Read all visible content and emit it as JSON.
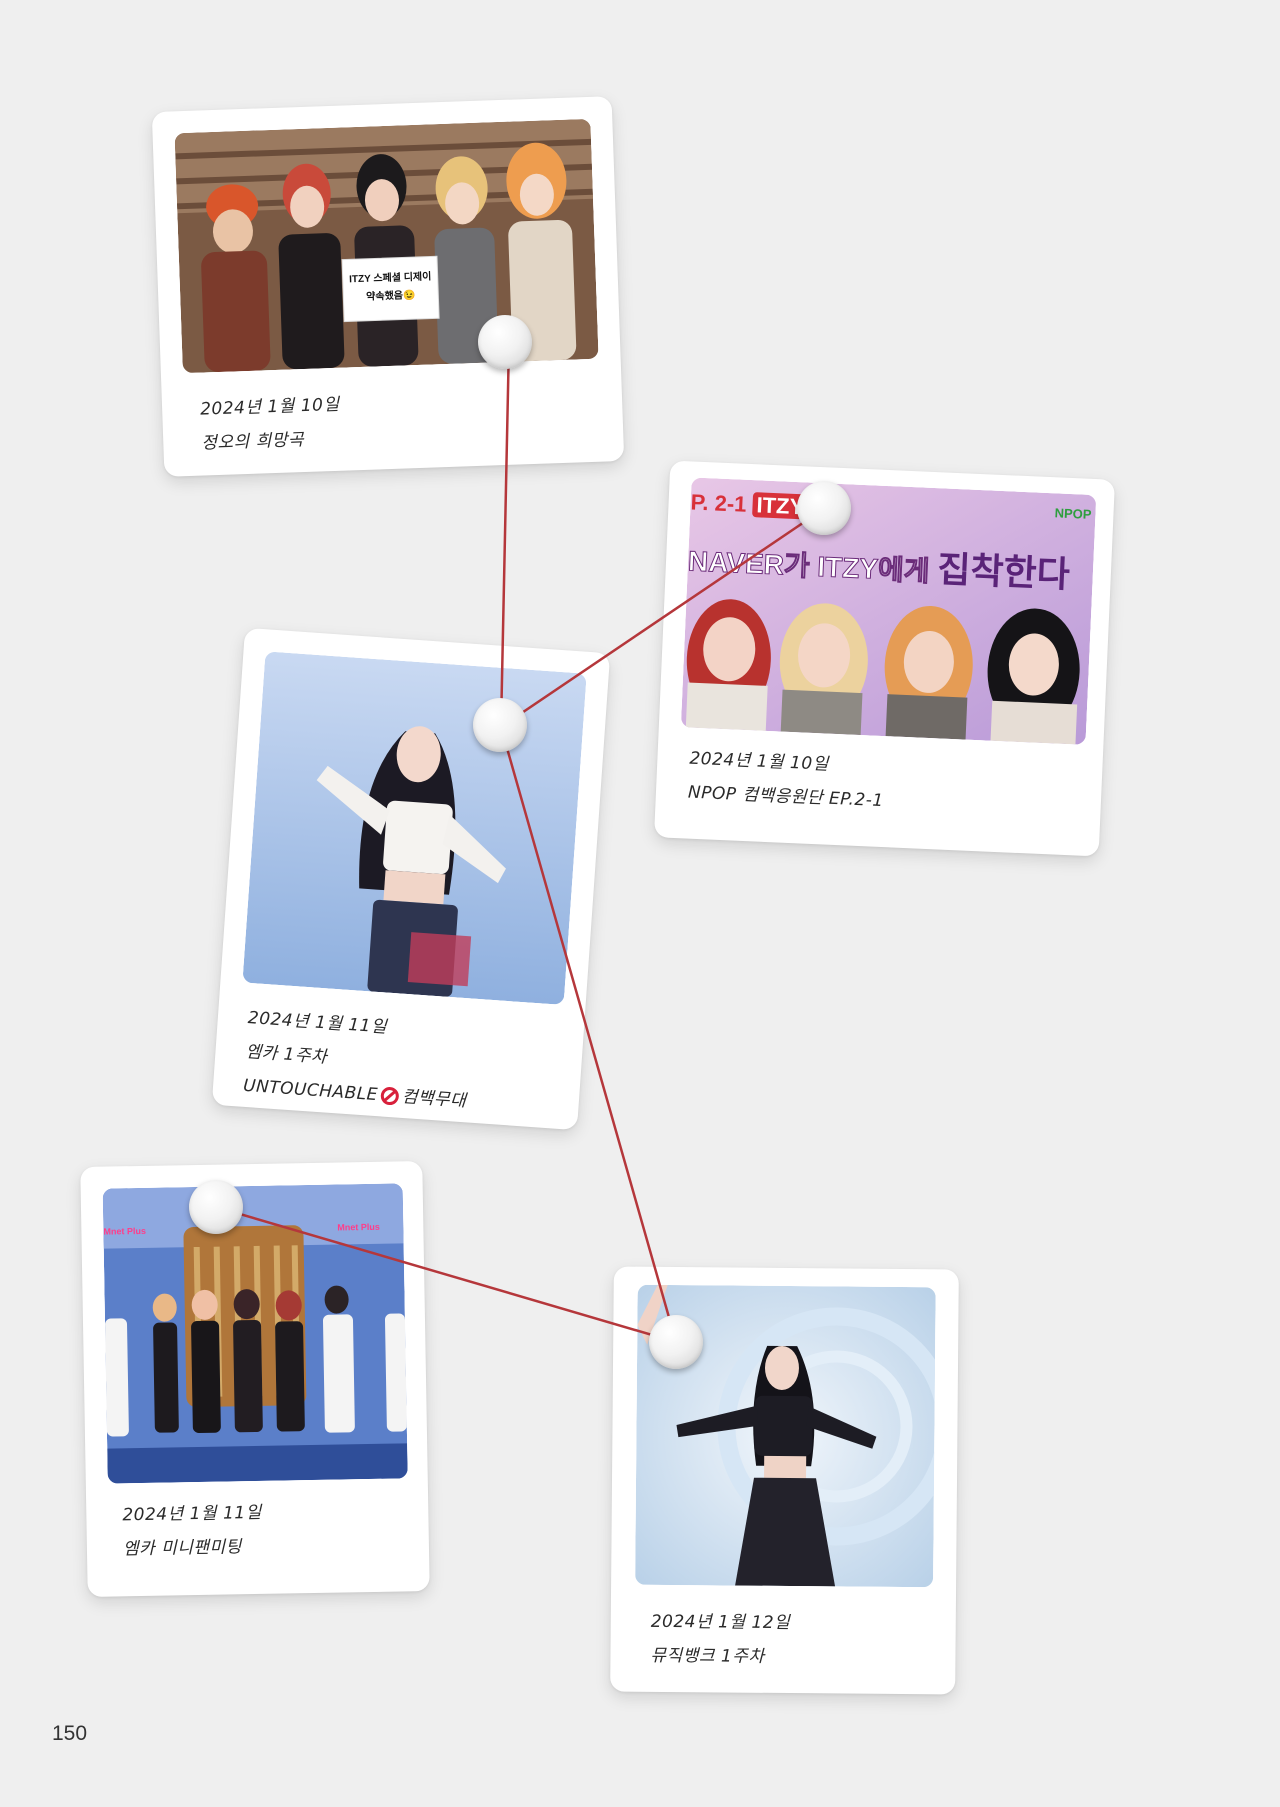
{
  "page_number": "150",
  "cards": [
    {
      "id": "card-1",
      "lines": [
        "2024년 1월 10일",
        "정오의 희망곡"
      ],
      "photo_sign_lines": [
        "ITZY 스페셜 디제이",
        "약속했음😉"
      ]
    },
    {
      "id": "card-2",
      "lines": [
        "2024년 1월 10일",
        "NPOP 컴백응원단 EP.2-1"
      ],
      "photo_overlay": {
        "episode": "P. 2-1",
        "group": "ITZY",
        "headline_part1": "NAVER가 ITZY에게",
        "headline_part2": "집착한다",
        "badge": "NPOP"
      }
    },
    {
      "id": "card-3",
      "lines": [
        "2024년 1월 11일",
        "엠카 1주차"
      ],
      "line3_prefix": "UNTOUCHABLE",
      "line3_suffix": "컴백무대"
    },
    {
      "id": "card-4",
      "lines": [
        "2024년 1월 11일",
        "엠카 미니팬미팅"
      ],
      "photo_logo": "Mnet Plus"
    },
    {
      "id": "card-5",
      "lines": [
        "2024년 1월 12일",
        "뮤직뱅크 1주차"
      ]
    }
  ],
  "colors": {
    "background": "#efefef",
    "string": "#b5373b",
    "card": "#ffffff"
  }
}
